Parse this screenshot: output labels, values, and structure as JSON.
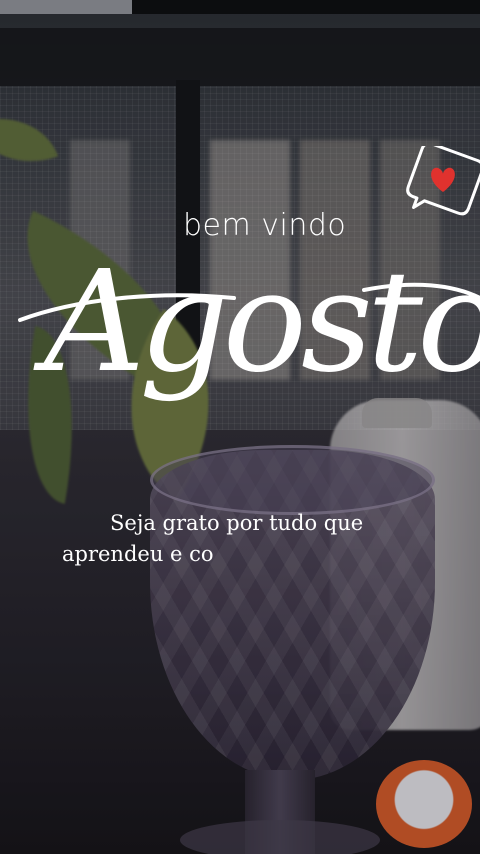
{
  "greeting": "bem vindo",
  "month": "Agosto",
  "message": {
    "line1": "Seja grato por tudo que",
    "line2": "aprendeu e co"
  },
  "icons": {
    "sticker": "heart-speech-bubble-icon"
  },
  "colors": {
    "text": "#ffffff",
    "heart": "#e0322e"
  }
}
